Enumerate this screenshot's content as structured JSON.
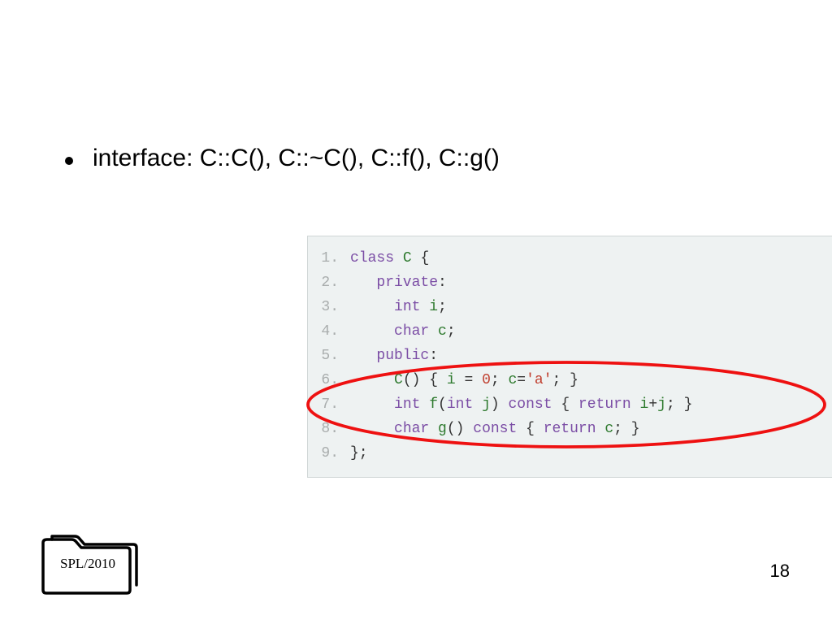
{
  "bullet": {
    "text": "interface: C::C(), C::~C(), C::f(), C::g()"
  },
  "code": {
    "lines": [
      {
        "n": "1.",
        "tokens": [
          {
            "cls": "kw",
            "t": "class"
          },
          {
            "cls": "plain",
            "t": " "
          },
          {
            "cls": "name",
            "t": "C"
          },
          {
            "cls": "plain",
            "t": " {"
          }
        ]
      },
      {
        "n": "2.",
        "tokens": [
          {
            "cls": "plain",
            "t": "   "
          },
          {
            "cls": "kw",
            "t": "private"
          },
          {
            "cls": "plain",
            "t": ":"
          }
        ]
      },
      {
        "n": "3.",
        "tokens": [
          {
            "cls": "plain",
            "t": "     "
          },
          {
            "cls": "kw",
            "t": "int"
          },
          {
            "cls": "plain",
            "t": " "
          },
          {
            "cls": "name",
            "t": "i"
          },
          {
            "cls": "plain",
            "t": ";"
          }
        ]
      },
      {
        "n": "4.",
        "tokens": [
          {
            "cls": "plain",
            "t": "     "
          },
          {
            "cls": "kw",
            "t": "char"
          },
          {
            "cls": "plain",
            "t": " "
          },
          {
            "cls": "name",
            "t": "c"
          },
          {
            "cls": "plain",
            "t": ";"
          }
        ]
      },
      {
        "n": "5.",
        "tokens": [
          {
            "cls": "plain",
            "t": "   "
          },
          {
            "cls": "kw",
            "t": "public"
          },
          {
            "cls": "plain",
            "t": ":"
          }
        ]
      },
      {
        "n": "6.",
        "tokens": [
          {
            "cls": "plain",
            "t": "     "
          },
          {
            "cls": "name",
            "t": "C"
          },
          {
            "cls": "plain",
            "t": "() { "
          },
          {
            "cls": "name",
            "t": "i"
          },
          {
            "cls": "plain",
            "t": " = "
          },
          {
            "cls": "num",
            "t": "0"
          },
          {
            "cls": "plain",
            "t": "; "
          },
          {
            "cls": "name",
            "t": "c"
          },
          {
            "cls": "plain",
            "t": "="
          },
          {
            "cls": "str",
            "t": "'a'"
          },
          {
            "cls": "plain",
            "t": "; }"
          }
        ]
      },
      {
        "n": "7.",
        "tokens": [
          {
            "cls": "plain",
            "t": "     "
          },
          {
            "cls": "kw",
            "t": "int"
          },
          {
            "cls": "plain",
            "t": " "
          },
          {
            "cls": "name",
            "t": "f"
          },
          {
            "cls": "plain",
            "t": "("
          },
          {
            "cls": "kw",
            "t": "int"
          },
          {
            "cls": "plain",
            "t": " "
          },
          {
            "cls": "name",
            "t": "j"
          },
          {
            "cls": "plain",
            "t": ") "
          },
          {
            "cls": "kw",
            "t": "const"
          },
          {
            "cls": "plain",
            "t": " { "
          },
          {
            "cls": "kw",
            "t": "return"
          },
          {
            "cls": "plain",
            "t": " "
          },
          {
            "cls": "name",
            "t": "i"
          },
          {
            "cls": "plain",
            "t": "+"
          },
          {
            "cls": "name",
            "t": "j"
          },
          {
            "cls": "plain",
            "t": "; }"
          }
        ]
      },
      {
        "n": "8.",
        "tokens": [
          {
            "cls": "plain",
            "t": "     "
          },
          {
            "cls": "kw",
            "t": "char"
          },
          {
            "cls": "plain",
            "t": " "
          },
          {
            "cls": "name",
            "t": "g"
          },
          {
            "cls": "plain",
            "t": "() "
          },
          {
            "cls": "kw",
            "t": "const"
          },
          {
            "cls": "plain",
            "t": " { "
          },
          {
            "cls": "kw",
            "t": "return"
          },
          {
            "cls": "plain",
            "t": " "
          },
          {
            "cls": "name",
            "t": "c"
          },
          {
            "cls": "plain",
            "t": "; }"
          }
        ]
      },
      {
        "n": "9.",
        "tokens": [
          {
            "cls": "plain",
            "t": "};"
          }
        ]
      }
    ]
  },
  "footer": {
    "folder_label": "SPL/2010",
    "page": "18"
  }
}
